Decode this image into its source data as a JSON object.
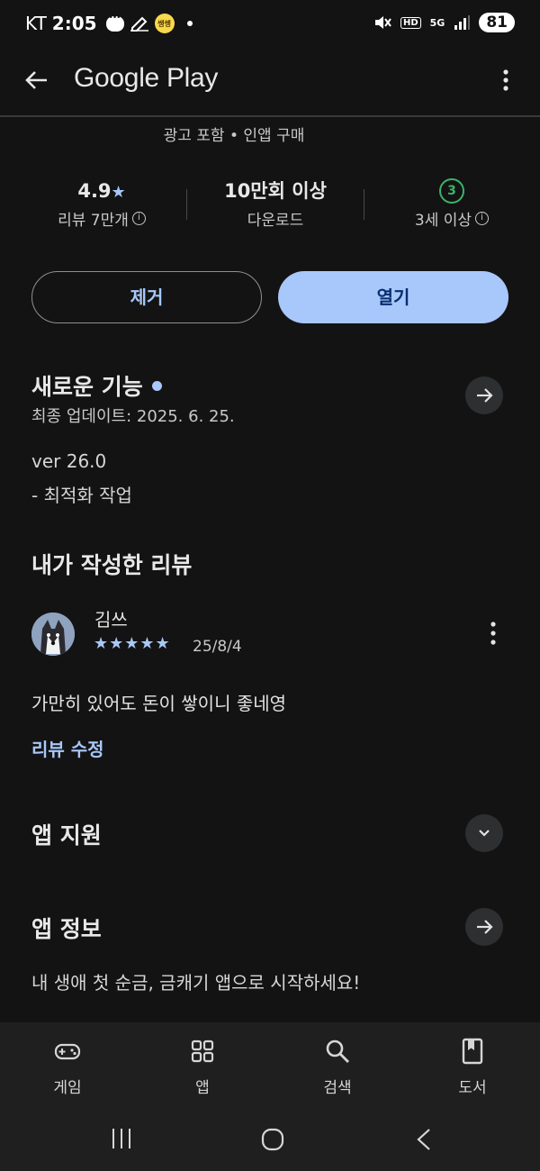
{
  "status_bar": {
    "carrier": "KT",
    "time": "2:05",
    "kakao_badge_text": "쌩쌩",
    "network_label": "5G",
    "hd_label": "HD",
    "battery": "81"
  },
  "app_bar": {
    "title": "Google Play"
  },
  "app_meta": "광고 포함 • 인앱 구매",
  "stats": {
    "rating_value": "4.9",
    "rating_label": "리뷰 7만개",
    "downloads_value": "10만회 이상",
    "downloads_label": "다운로드",
    "age_value": "3",
    "age_label": "3세 이상"
  },
  "actions": {
    "remove_label": "제거",
    "open_label": "열기"
  },
  "whats_new": {
    "title": "새로운 기능",
    "last_updated": "최종 업데이트: 2025. 6. 25.",
    "version": "ver 26.0",
    "notes": "- 최적화 작업"
  },
  "my_review": {
    "title": "내가 작성한 리뷰",
    "reviewer": "김쓰",
    "rating": 5,
    "stars": "★★★★★",
    "date": "25/8/4",
    "text": "가만히 있어도 돈이 쌓이니 좋네영",
    "edit_label": "리뷰 수정"
  },
  "app_support": {
    "title": "앱 지원"
  },
  "app_info": {
    "title": "앱 정보",
    "description": "내 생애 첫 순금, 금캐기 앱으로 시작하세요!"
  },
  "bottom_nav": {
    "items": [
      {
        "label": "게임",
        "icon": "gamepad-icon"
      },
      {
        "label": "앱",
        "icon": "apps-grid-icon"
      },
      {
        "label": "검색",
        "icon": "search-icon"
      },
      {
        "label": "도서",
        "icon": "book-icon"
      }
    ]
  },
  "colors": {
    "background": "#131313",
    "accent": "#a8c7fa",
    "primary_button": "#a8c7fa",
    "age_badge": "#3bb36a"
  }
}
